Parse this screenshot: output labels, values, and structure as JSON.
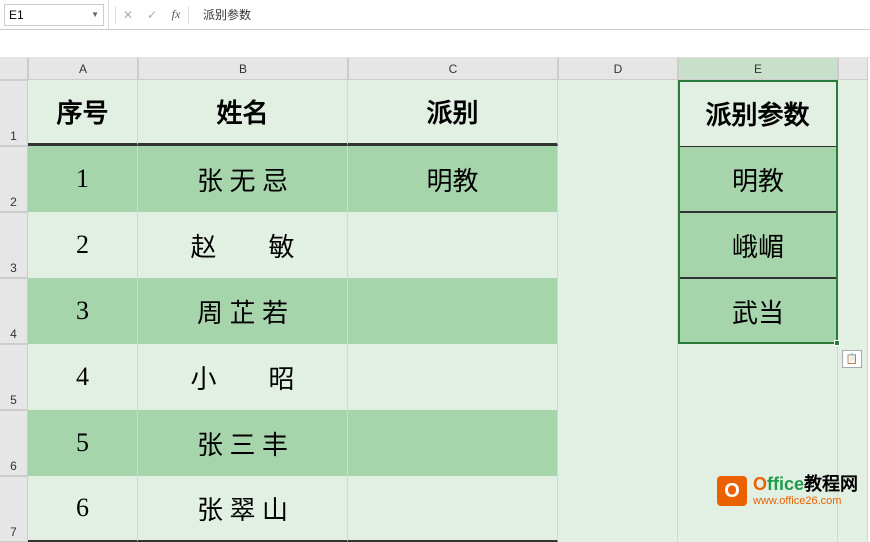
{
  "formula_bar": {
    "name_box": "E1",
    "formula": "派别参数"
  },
  "columns": [
    "A",
    "B",
    "C",
    "D",
    "E"
  ],
  "rows": [
    "1",
    "2",
    "3",
    "4",
    "5",
    "6",
    "7"
  ],
  "table": {
    "headers": {
      "seq": "序号",
      "name": "姓名",
      "faction": "派别"
    },
    "rows": [
      {
        "seq": "1",
        "name": "张 无 忌",
        "faction": "明教"
      },
      {
        "seq": "2",
        "name": "赵　　敏",
        "faction": ""
      },
      {
        "seq": "3",
        "name": "周 芷 若",
        "faction": ""
      },
      {
        "seq": "4",
        "name": "小　　昭",
        "faction": ""
      },
      {
        "seq": "5",
        "name": "张 三 丰",
        "faction": ""
      },
      {
        "seq": "6",
        "name": "张 翠 山",
        "faction": ""
      }
    ]
  },
  "params": {
    "header": "派别参数",
    "items": [
      "明教",
      "峨嵋",
      "武当"
    ]
  },
  "selected_cell": "E1",
  "watermark": {
    "brand_o": "O",
    "brand_rest": "ffice",
    "brand_cn": "教程网",
    "url": "www.office26.com",
    "icon_letter": "O"
  }
}
